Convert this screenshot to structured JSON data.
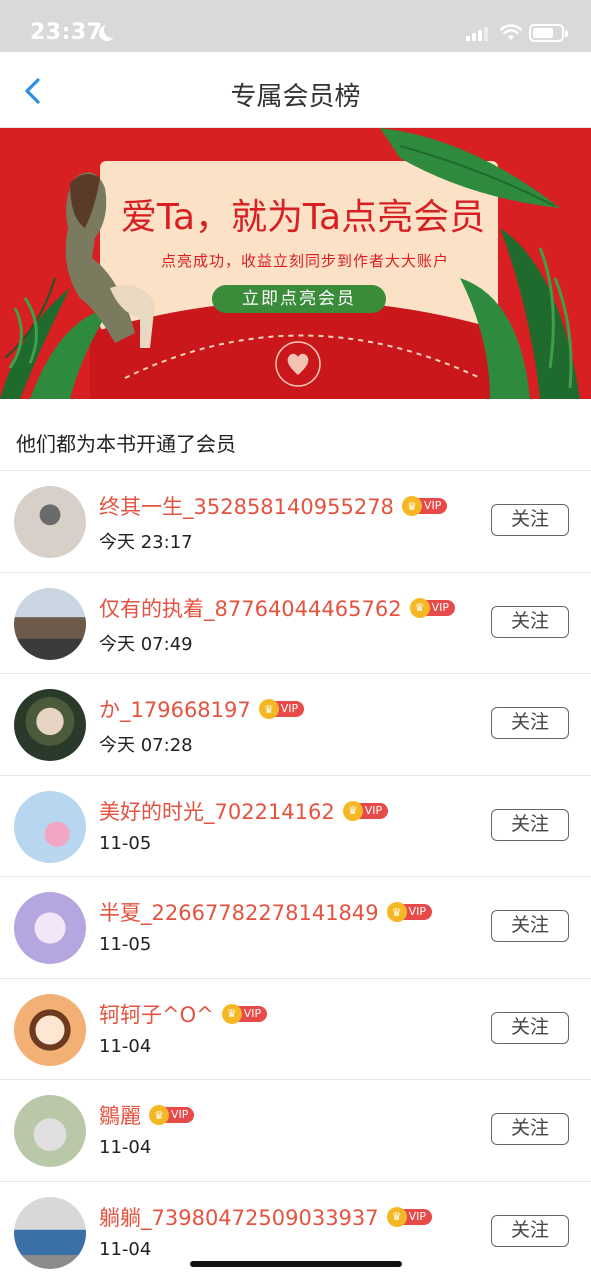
{
  "status_bar": {
    "time": "23:37"
  },
  "nav": {
    "title": "专属会员榜"
  },
  "banner": {
    "headline": "爱Ta，就为Ta点亮会员",
    "subtitle": "点亮成功，收益立刻同步到作者大大账户",
    "cta_label": "立即点亮会员",
    "accent_color": "#d81f22"
  },
  "section": {
    "header": "他们都为本书开通了会员"
  },
  "vip_label": "VIP",
  "follow_label": "关注",
  "members": [
    {
      "name": "终其一生_352858140955278",
      "time": "今天 23:17"
    },
    {
      "name": "仅有的执着_87764044465762",
      "time": "今天 07:49"
    },
    {
      "name": "か_179668197",
      "time": "今天 07:28"
    },
    {
      "name": "美好的时光_702214162",
      "time": "11-05"
    },
    {
      "name": "半夏_22667782278141849",
      "time": "11-05"
    },
    {
      "name": "轲轲子^O^",
      "time": "11-04"
    },
    {
      "name": "鶵麗",
      "time": "11-04"
    },
    {
      "name": "躺躺_73980472509033937",
      "time": "11-04"
    }
  ]
}
